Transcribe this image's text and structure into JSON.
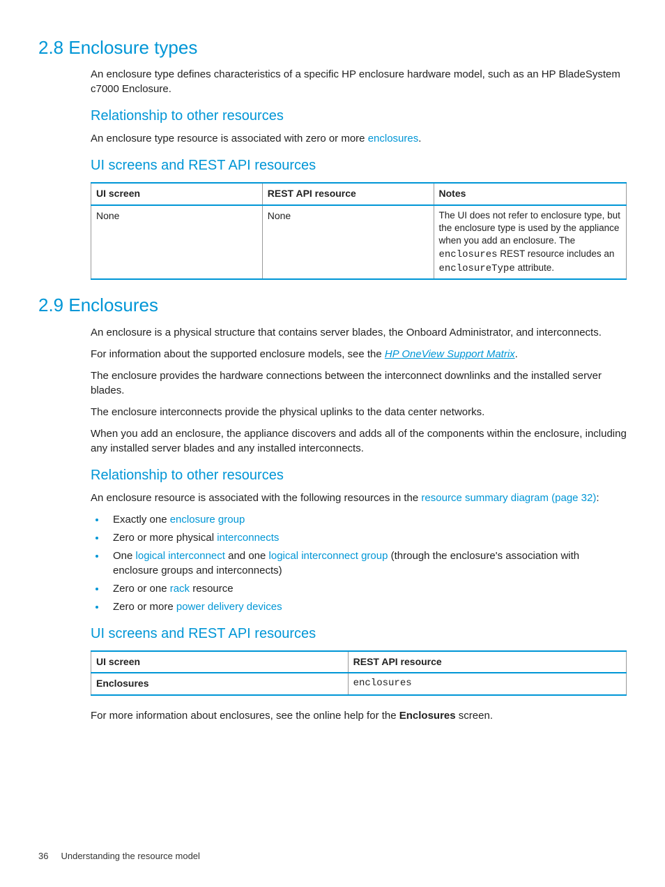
{
  "section28": {
    "heading": "2.8 Enclosure types",
    "intro": "An enclosure type defines characteristics of a specific HP enclosure hardware model, such as an HP BladeSystem c7000 Enclosure.",
    "rel_heading": "Relationship to other resources",
    "rel_text_before": "An enclosure type resource is associated with zero or more ",
    "rel_link": "enclosures",
    "rel_text_after": ".",
    "ui_heading": "UI screens and REST API resources",
    "table": {
      "headers": [
        "UI screen",
        "REST API resource",
        "Notes"
      ],
      "row": {
        "ui": "None",
        "rest": "None",
        "notes_p1": "The UI does not refer to enclosure type, but the enclosure type is used by the appliance when you add an enclosure. The ",
        "notes_code1": "enclosures",
        "notes_p2": " REST resource includes an ",
        "notes_code2": "enclosureType",
        "notes_p3": " attribute."
      }
    }
  },
  "section29": {
    "heading": "2.9 Enclosures",
    "p1": "An enclosure is a physical structure that contains server blades, the Onboard Administrator, and interconnects.",
    "p2_before": "For information about the supported enclosure models, see the ",
    "p2_link": "HP OneView Support Matrix",
    "p2_after": ".",
    "p3": "The enclosure provides the hardware connections between the interconnect downlinks and the installed server blades.",
    "p4": "The enclosure interconnects provide the physical uplinks to the data center networks.",
    "p5": "When you add an enclosure, the appliance discovers and adds all of the components within the enclosure, including any installed server blades and any installed interconnects.",
    "rel_heading": "Relationship to other resources",
    "rel_text_before": "An enclosure resource is associated with the following resources in the ",
    "rel_link": "resource summary diagram (page 32)",
    "rel_text_after": ":",
    "bullets": {
      "b1_before": "Exactly one ",
      "b1_link": "enclosure group",
      "b2_before": "Zero or more physical ",
      "b2_link": "interconnects",
      "b3_before": "One ",
      "b3_link1": "logical interconnect",
      "b3_mid": " and one ",
      "b3_link2": "logical interconnect group",
      "b3_after": " (through the enclosure's association with enclosure groups and interconnects)",
      "b4_before": "Zero or one ",
      "b4_link": "rack",
      "b4_after": " resource",
      "b5_before": "Zero or more ",
      "b5_link": "power delivery devices"
    },
    "ui_heading": "UI screens and REST API resources",
    "table": {
      "headers": [
        "UI screen",
        "REST API resource"
      ],
      "row": {
        "ui": "Enclosures",
        "rest": "enclosures"
      }
    },
    "footer_before": "For more information about enclosures, see the online help for the ",
    "footer_bold": "Enclosures",
    "footer_after": " screen."
  },
  "page_footer": {
    "num": "36",
    "title": "Understanding the resource model"
  }
}
